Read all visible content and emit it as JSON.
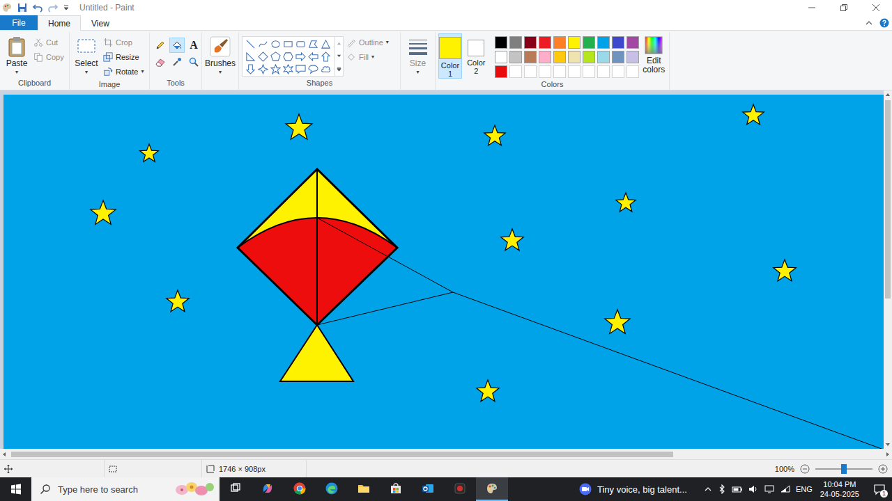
{
  "window": {
    "title": "Untitled - Paint"
  },
  "tabs": [
    {
      "label": "File",
      "kind": "file",
      "selected": false
    },
    {
      "label": "Home",
      "kind": "tab",
      "selected": true
    },
    {
      "label": "View",
      "kind": "tab",
      "selected": false
    }
  ],
  "clipboard": {
    "label": "Clipboard",
    "paste": "Paste",
    "items": [
      {
        "label": "Cut",
        "disabled": true
      },
      {
        "label": "Copy",
        "disabled": true
      }
    ]
  },
  "image": {
    "label": "Image",
    "select": "Select",
    "items": [
      {
        "label": "Crop",
        "disabled": true,
        "dropdown": false
      },
      {
        "label": "Resize",
        "disabled": false,
        "dropdown": false
      },
      {
        "label": "Rotate",
        "disabled": false,
        "dropdown": true
      }
    ]
  },
  "tools": {
    "label": "Tools",
    "items": [
      {
        "kind": "pencil",
        "selected": false
      },
      {
        "kind": "fill",
        "selected": true
      },
      {
        "kind": "text",
        "text": "A",
        "selected": false
      },
      {
        "kind": "eraser",
        "selected": false
      },
      {
        "kind": "picker",
        "selected": false
      },
      {
        "kind": "magnifier",
        "selected": false
      }
    ]
  },
  "brushes": {
    "label": "Brushes"
  },
  "shapes": {
    "label": "Shapes",
    "options": [
      {
        "label": "Outline",
        "disabled": true
      },
      {
        "label": "Fill",
        "disabled": true
      }
    ]
  },
  "size": {
    "label": "Size",
    "disabled": true
  },
  "colors": {
    "label": "Colors",
    "slots": [
      {
        "label": "Color 1",
        "color": "#fff200",
        "selected": true
      },
      {
        "label": "Color 2",
        "color": "#ffffff",
        "selected": false
      }
    ],
    "palette": [
      {
        "color": "#000000",
        "empty": false
      },
      {
        "color": "#7f7f7f",
        "empty": false
      },
      {
        "color": "#880015",
        "empty": false
      },
      {
        "color": "#ed1c24",
        "empty": false
      },
      {
        "color": "#ff7f27",
        "empty": false
      },
      {
        "color": "#fff200",
        "empty": false
      },
      {
        "color": "#22b14c",
        "empty": false
      },
      {
        "color": "#00a2e8",
        "empty": false
      },
      {
        "color": "#3f48cc",
        "empty": false
      },
      {
        "color": "#a349a4",
        "empty": false
      },
      {
        "color": "#ffffff",
        "empty": false
      },
      {
        "color": "#c3c3c3",
        "empty": false
      },
      {
        "color": "#b97a57",
        "empty": false
      },
      {
        "color": "#ffaec9",
        "empty": false
      },
      {
        "color": "#ffc90e",
        "empty": false
      },
      {
        "color": "#efe4b0",
        "empty": false
      },
      {
        "color": "#b5e61d",
        "empty": false
      },
      {
        "color": "#99d9ea",
        "empty": false
      },
      {
        "color": "#7092be",
        "empty": false
      },
      {
        "color": "#c8bfe7",
        "empty": false
      },
      {
        "color": "#e80c0c",
        "empty": false
      },
      {
        "color": "#ffffff",
        "empty": true
      },
      {
        "color": "#ffffff",
        "empty": true
      },
      {
        "color": "#ffffff",
        "empty": true
      },
      {
        "color": "#ffffff",
        "empty": true
      },
      {
        "color": "#ffffff",
        "empty": true
      },
      {
        "color": "#ffffff",
        "empty": true
      },
      {
        "color": "#ffffff",
        "empty": true
      },
      {
        "color": "#ffffff",
        "empty": true
      },
      {
        "color": "#ffffff",
        "empty": true
      }
    ],
    "edit": "Edit colors"
  },
  "status_bar": {
    "dimensions": "1746 × 908px",
    "zoom": "100%",
    "zoom_level": 0.5
  },
  "taskbar": {
    "search_placeholder": "Type here to search",
    "apps": [
      {
        "kind": "taskview",
        "active": false
      },
      {
        "kind": "copilot",
        "active": false
      },
      {
        "kind": "chrome",
        "active": false
      },
      {
        "kind": "edge",
        "active": false
      },
      {
        "kind": "explorer",
        "active": false
      },
      {
        "kind": "store",
        "active": false
      },
      {
        "kind": "outlook",
        "active": false
      },
      {
        "kind": "recorder",
        "active": false
      },
      {
        "kind": "paint",
        "active": true
      }
    ],
    "media": "Tiny voice, big talent...",
    "language": "ENG",
    "time": "10:04 PM",
    "date": "24-05-2025",
    "notifications": "1"
  }
}
